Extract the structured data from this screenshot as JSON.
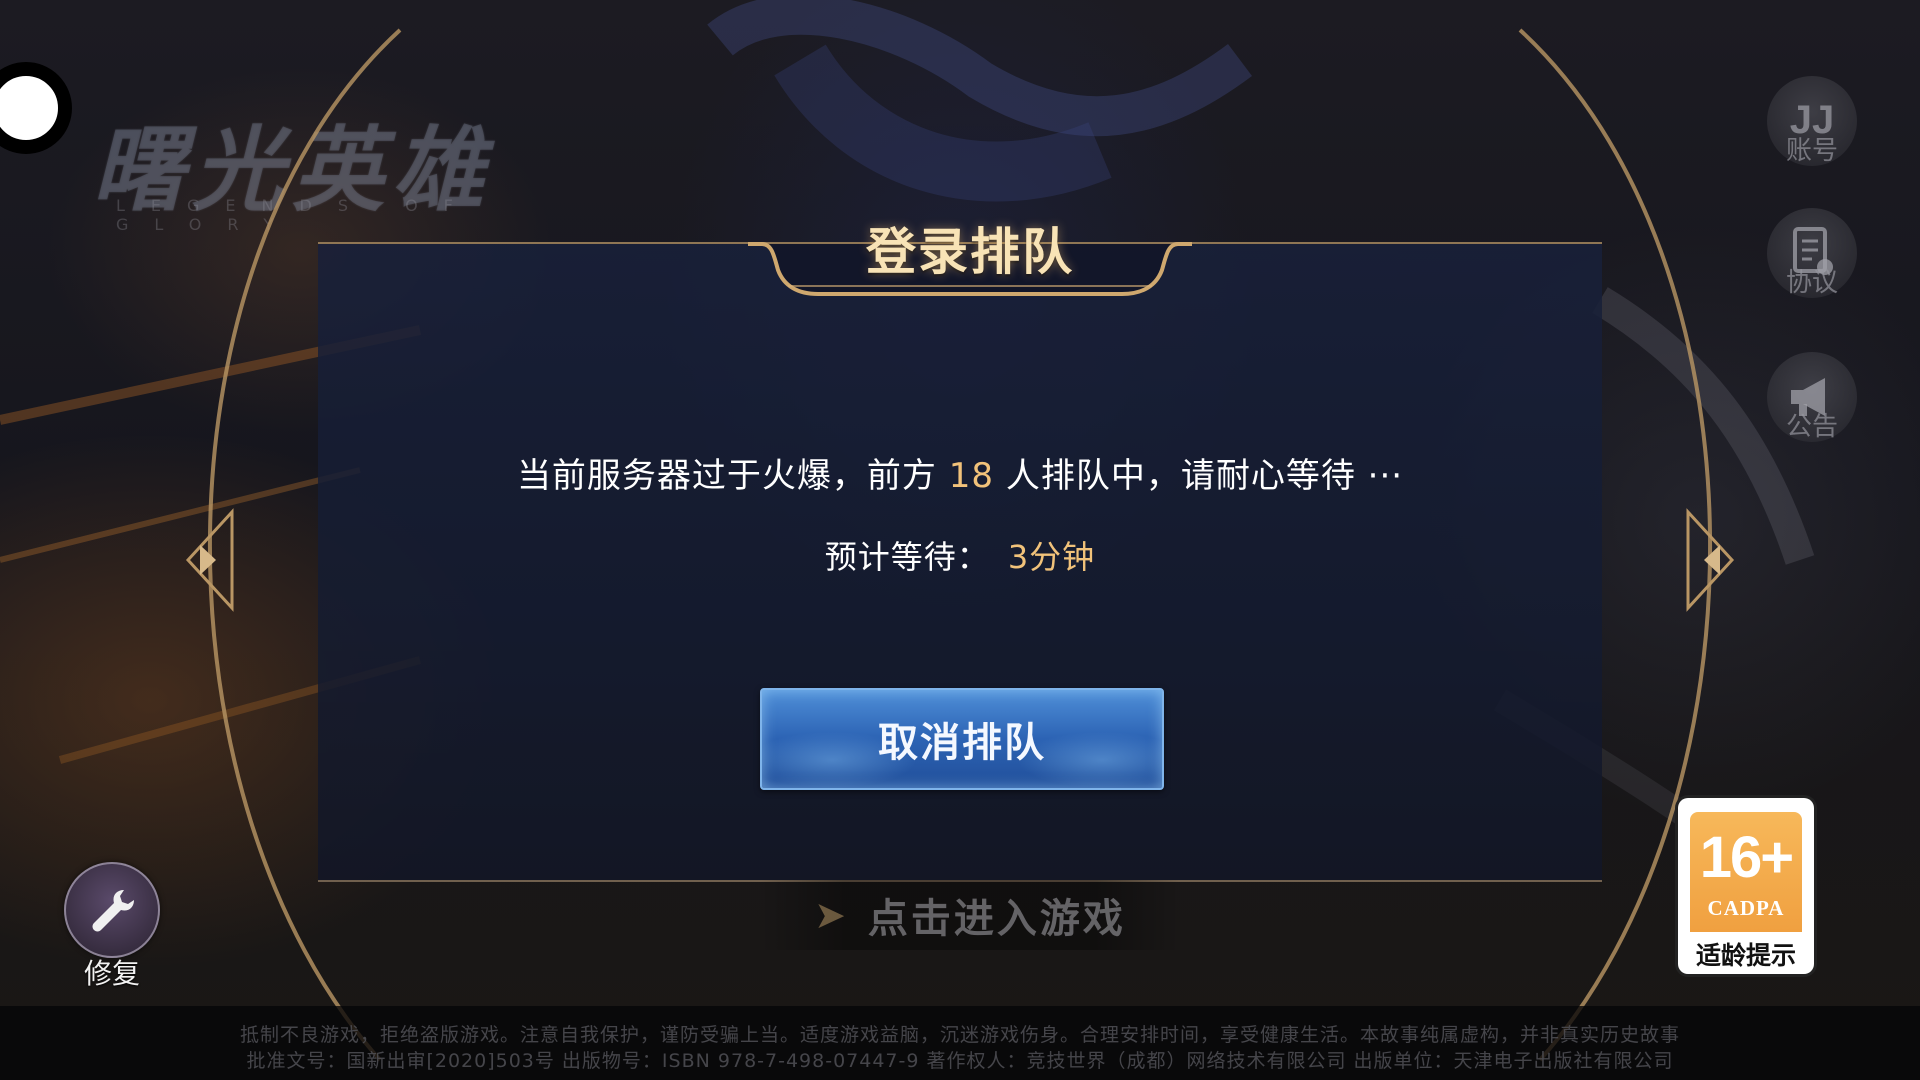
{
  "logo": {
    "title": "曙光英雄",
    "subtitle": "LEGENDS OF GLORY"
  },
  "dialog": {
    "title": "登录排队",
    "message_before": "当前服务器过于火爆，前方 ",
    "queue_count": "18",
    "message_after": " 人排队中，请耐心等待 ···",
    "eta_label": "预计等待：",
    "eta_value": "3分钟",
    "cancel_label": "取消排队"
  },
  "enter_game": {
    "label": "点击进入游戏",
    "icon": "arrow-right-icon"
  },
  "side_menu": [
    {
      "label": "账号",
      "icon": "account-icon"
    },
    {
      "label": "协议",
      "icon": "agreement-icon"
    },
    {
      "label": "公告",
      "icon": "announcement-icon"
    }
  ],
  "repair": {
    "label": "修复",
    "icon": "wrench-icon"
  },
  "age_rating": {
    "rating": "16+",
    "org": "CADPA",
    "tip": "适龄提示",
    "color": "#f0a040"
  },
  "footer": {
    "line1": "抵制不良游戏，拒绝盗版游戏。注意自我保护，谨防受骗上当。适度游戏益脑，沉迷游戏伤身。合理安排时间，享受健康生活。本故事纯属虚构，并非真实历史故事",
    "line2": "批准文号：国新出审[2020]503号  出版物号：ISBN 978-7-498-07447-9  著作权人：竞技世界（成都）网络技术有限公司  出版单位：天津电子出版社有限公司"
  },
  "colors": {
    "accent_gold": "#f1c27a",
    "button_blue": "#2c63b4",
    "frame_gold": "#b99664"
  }
}
